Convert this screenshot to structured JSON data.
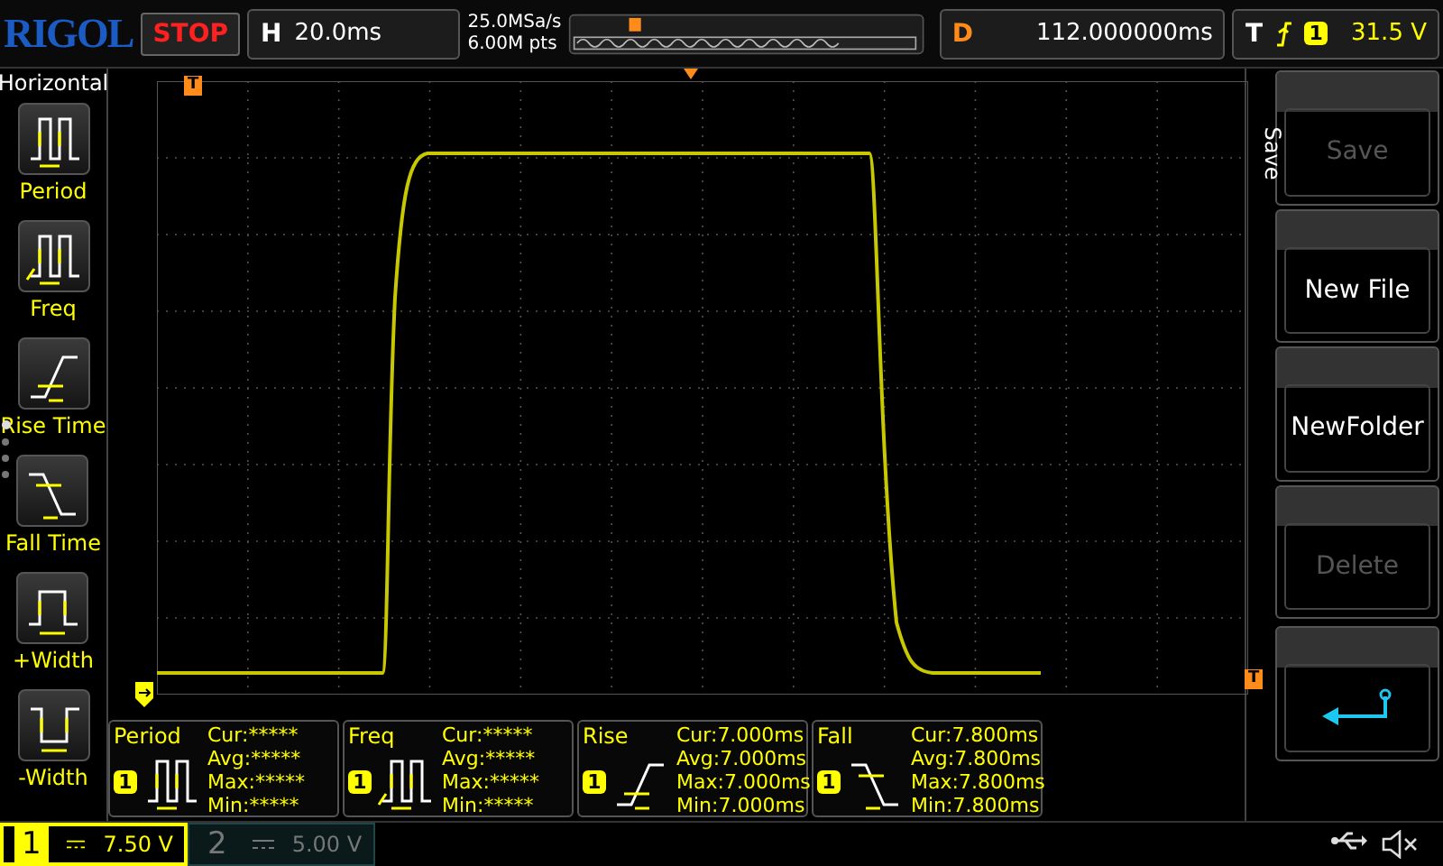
{
  "brand": "RIGOL",
  "run_state": "STOP",
  "horizontal": {
    "label": "H",
    "timebase": "20.0ms"
  },
  "acquisition": {
    "sample_rate": "25.0MSa/s",
    "memory_depth": "6.00M pts"
  },
  "delay": {
    "label": "D",
    "value": "112.000000ms"
  },
  "trigger": {
    "label": "T",
    "source": "1",
    "level": "31.5 V"
  },
  "markers": {
    "trigger_position": "T",
    "trigger_level": "T"
  },
  "left_menu": {
    "title": "Horizontal",
    "pages": [
      {
        "selected": true
      },
      {
        "selected": false
      },
      {
        "selected": false
      },
      {
        "selected": false
      }
    ],
    "items": [
      {
        "label": "Period",
        "kind": "period"
      },
      {
        "label": "Freq",
        "kind": "freq"
      },
      {
        "label": "Rise Time",
        "kind": "rise"
      },
      {
        "label": "Fall Time",
        "kind": "fall"
      },
      {
        "label": "+Width",
        "kind": "pwidth"
      },
      {
        "label": "-Width",
        "kind": "nwidth"
      }
    ]
  },
  "right_menu": {
    "title": "Save",
    "buttons": [
      {
        "kind": "text",
        "label": "Save",
        "disabled": true
      },
      {
        "kind": "text",
        "label": "New File",
        "disabled": false
      },
      {
        "kind": "text",
        "label": "NewFolder",
        "disabled": false
      },
      {
        "kind": "text",
        "label": "Delete",
        "disabled": true
      },
      {
        "kind": "back",
        "disabled": false
      }
    ]
  },
  "measurements": [
    {
      "name": "Period",
      "kind": "period",
      "channel": "1",
      "rows": [
        {
          "label": "Cur:",
          "value": "*****"
        },
        {
          "label": "Avg:",
          "value": "*****"
        },
        {
          "label": "Max:",
          "value": "*****"
        },
        {
          "label": "Min:",
          "value": "*****"
        }
      ]
    },
    {
      "name": "Freq",
      "kind": "freq",
      "channel": "1",
      "rows": [
        {
          "label": "Cur:",
          "value": "*****"
        },
        {
          "label": "Avg:",
          "value": "*****"
        },
        {
          "label": "Max:",
          "value": "*****"
        },
        {
          "label": "Min:",
          "value": "*****"
        }
      ]
    },
    {
      "name": "Rise",
      "kind": "rise",
      "channel": "1",
      "rows": [
        {
          "label": "Cur:",
          "value": "7.000ms"
        },
        {
          "label": "Avg:",
          "value": "7.000ms"
        },
        {
          "label": "Max:",
          "value": "7.000ms"
        },
        {
          "label": "Min:",
          "value": "7.000ms"
        }
      ]
    },
    {
      "name": "Fall",
      "kind": "fall",
      "channel": "1",
      "rows": [
        {
          "label": "Cur:",
          "value": "7.800ms"
        },
        {
          "label": "Avg:",
          "value": "7.800ms"
        },
        {
          "label": "Max:",
          "value": "7.800ms"
        },
        {
          "label": "Min:",
          "value": "7.800ms"
        }
      ]
    }
  ],
  "channels": [
    {
      "number": "1",
      "scale": "7.50 V",
      "on": true
    },
    {
      "number": "2",
      "scale": "5.00 V",
      "on": false
    }
  ]
}
